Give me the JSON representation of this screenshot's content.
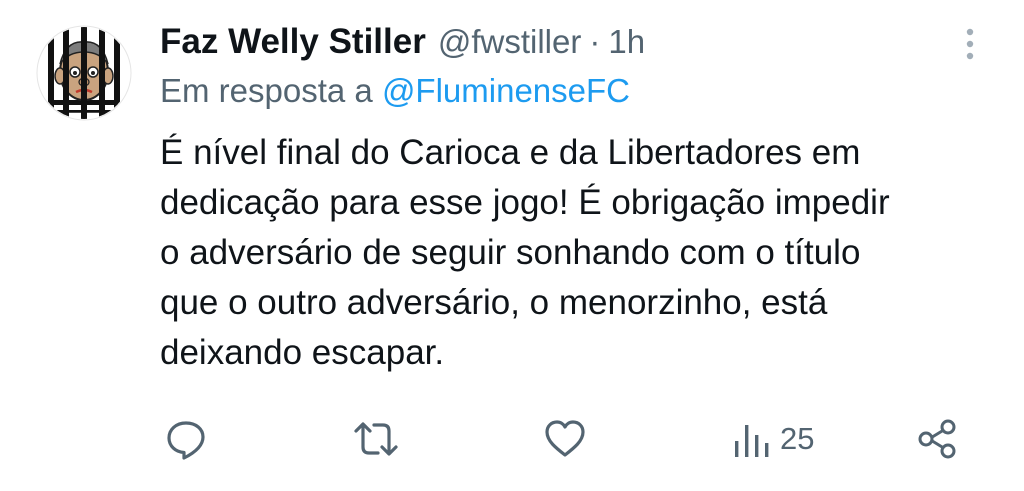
{
  "tweet": {
    "author": {
      "display_name": "Faz Welly Stiller",
      "handle": "@fwstiller",
      "avatar_icon": "prisoner-cartoon-avatar"
    },
    "separator": "·",
    "time": "1h",
    "reply": {
      "prefix": "Em resposta a",
      "mention": "@FluminenseFC"
    },
    "text": "É nível final do Carioca e da Libertadores em\ndedicação para esse jogo! É obrigação impedir\no adversário de seguir sonhando com o título\nque o outro adversário, o menorzinho, está\ndeixando escapar.",
    "views": "25"
  },
  "icons": {
    "more": "vertical-dots-icon",
    "reply": "speech-bubble-icon",
    "retweet": "retweet-icon",
    "like": "heart-icon",
    "views": "bar-chart-icon",
    "share": "share-icon"
  },
  "colors": {
    "text": "#0f1419",
    "secondary": "#536471",
    "link": "#1d9bf0",
    "icon": "#536471"
  }
}
